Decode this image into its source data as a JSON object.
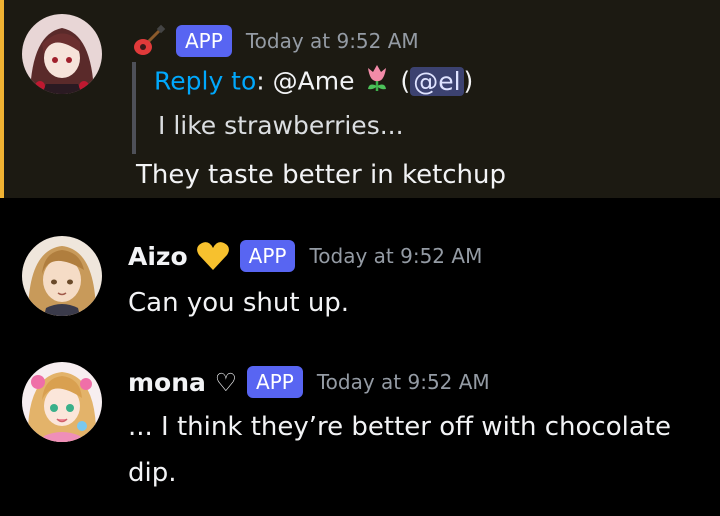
{
  "messages": [
    {
      "author": "",
      "author_icon": "guitar-icon",
      "badge": "APP",
      "timestamp": "Today at 9:52 AM",
      "reply": {
        "label": "Reply to",
        "target": "@Ame",
        "target_icon": "tulip-icon",
        "mention_prefix": "(",
        "mention": "@el",
        "mention_suffix": ")",
        "quoted_text": "I like strawberries..."
      },
      "content": "They taste better in ketchup",
      "highlighted": true
    },
    {
      "author": "Aizo",
      "author_icon": "yellow-heart-icon",
      "badge": "APP",
      "timestamp": "Today at 9:52 AM",
      "content": "Can you shut up."
    },
    {
      "author": "mona ♡",
      "badge": "APP",
      "timestamp": "Today at 9:52 AM",
      "content": "... I think they’re better off with chocolate dip."
    }
  ],
  "colors": {
    "background": "#000000",
    "highlight_background": "#1c1a12",
    "highlight_border": "#f0b232",
    "app_badge": "#5865f2",
    "reply_label": "#00a8fc",
    "timestamp": "#949ba4",
    "mention_bg": "#3c4270"
  }
}
